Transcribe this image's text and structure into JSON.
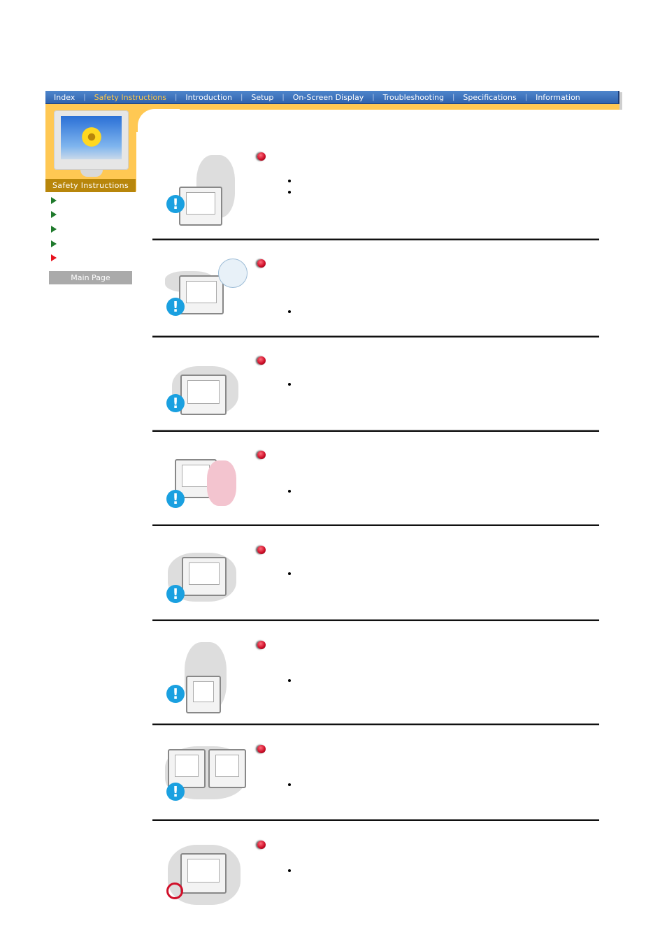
{
  "nav": {
    "items": [
      {
        "label": "Index",
        "active": false
      },
      {
        "label": "Safety Instructions",
        "active": true
      },
      {
        "label": "Introduction",
        "active": false
      },
      {
        "label": "Setup",
        "active": false
      },
      {
        "label": "On-Screen Display",
        "active": false
      },
      {
        "label": "Troubleshooting",
        "active": false
      },
      {
        "label": "Specifications",
        "active": false
      },
      {
        "label": "Information",
        "active": false
      }
    ],
    "colors": {
      "bar": "#2f62ad",
      "active_text": "#ffc94a",
      "band": "#ffc853"
    }
  },
  "sidebar": {
    "title": "Safety Instructions",
    "links": [
      {
        "icon": "green-arrow-icon",
        "label": ""
      },
      {
        "icon": "green-arrow-icon",
        "label": ""
      },
      {
        "icon": "green-arrow-icon",
        "label": ""
      },
      {
        "icon": "green-arrow-icon",
        "label": ""
      },
      {
        "icon": "red-arrow-icon",
        "label": ""
      }
    ],
    "main_page_label": "Main Page"
  },
  "sections": [
    {
      "illustration": "man-pointing-at-monitor",
      "badge": "warning-icon",
      "heading": "",
      "bullets": [
        "",
        ""
      ]
    },
    {
      "illustration": "monitor-unplug-power",
      "badge": "warning-icon",
      "heading": "",
      "bullets": [
        ""
      ]
    },
    {
      "illustration": "objects-on-monitor",
      "badge": "warning-icon",
      "heading": "",
      "bullets": [
        ""
      ]
    },
    {
      "illustration": "woman-near-monitor",
      "badge": "warning-icon",
      "heading": "",
      "bullets": [
        ""
      ]
    },
    {
      "illustration": "spray-near-monitor",
      "badge": "warning-icon",
      "heading": "",
      "bullets": [
        ""
      ]
    },
    {
      "illustration": "monitor-lifted-by-cable",
      "badge": "warning-icon",
      "heading": "",
      "bullets": [
        ""
      ]
    },
    {
      "illustration": "monitors-cable-pull",
      "badge": "warning-icon",
      "heading": "",
      "bullets": [
        ""
      ]
    },
    {
      "illustration": "screwdriver-shock",
      "badge": "no-touch-icon",
      "heading": "",
      "bullets": [
        ""
      ]
    }
  ]
}
